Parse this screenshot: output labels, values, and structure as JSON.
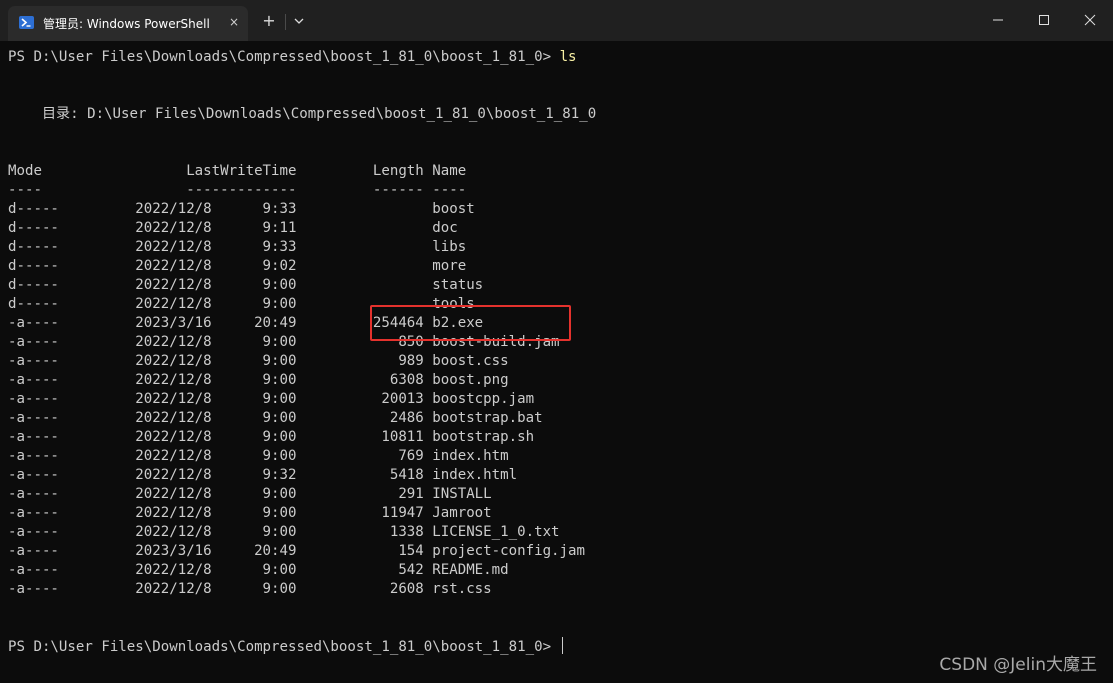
{
  "window": {
    "tab_title": "管理员: Windows PowerShell",
    "tab_close_icon": "×",
    "new_tab_icon": "+",
    "icons": {
      "tab": "powershell-icon",
      "close_tab": "close-icon",
      "new_tab": "plus-icon",
      "dropdown": "chevron-down-icon",
      "minimize": "minimize-icon",
      "maximize": "maximize-icon",
      "close": "close-icon"
    }
  },
  "terminal": {
    "prompt_1": "PS D:\\User Files\\Downloads\\Compressed\\boost_1_81_0\\boost_1_81_0>",
    "command_1": "ls",
    "directory_line": "    目录: D:\\User Files\\Downloads\\Compressed\\boost_1_81_0\\boost_1_81_0",
    "header_line": "Mode                 LastWriteTime         Length Name",
    "header_rule": "----                 -------------         ------ ----",
    "rows": [
      "d-----         2022/12/8      9:33                boost",
      "d-----         2022/12/8      9:11                doc",
      "d-----         2022/12/8      9:33                libs",
      "d-----         2022/12/8      9:02                more",
      "d-----         2022/12/8      9:00                status",
      "d-----         2022/12/8      9:00                tools",
      "-a----         2023/3/16     20:49         254464 b2.exe",
      "-a----         2022/12/8      9:00            850 boost-build.jam",
      "-a----         2022/12/8      9:00            989 boost.css",
      "-a----         2022/12/8      9:00           6308 boost.png",
      "-a----         2022/12/8      9:00          20013 boostcpp.jam",
      "-a----         2022/12/8      9:00           2486 bootstrap.bat",
      "-a----         2022/12/8      9:00          10811 bootstrap.sh",
      "-a----         2022/12/8      9:00            769 index.htm",
      "-a----         2022/12/8      9:32           5418 index.html",
      "-a----         2022/12/8      9:00            291 INSTALL",
      "-a----         2022/12/8      9:00          11947 Jamroot",
      "-a----         2022/12/8      9:00           1338 LICENSE_1_0.txt",
      "-a----         2023/3/16     20:49            154 project-config.jam",
      "-a----         2022/12/8      9:00            542 README.md",
      "-a----         2022/12/8      9:00           2608 rst.css"
    ],
    "prompt_2": "PS D:\\User Files\\Downloads\\Compressed\\boost_1_81_0\\boost_1_81_0>"
  },
  "watermark": "CSDN @Jelin大魔王",
  "colors": {
    "background": "#0c0c0c",
    "text": "#cccccc",
    "command": "#f9f1a5",
    "highlight_box": "#e5322d",
    "titlebar": "#202020",
    "tab": "#2b2b2b"
  }
}
